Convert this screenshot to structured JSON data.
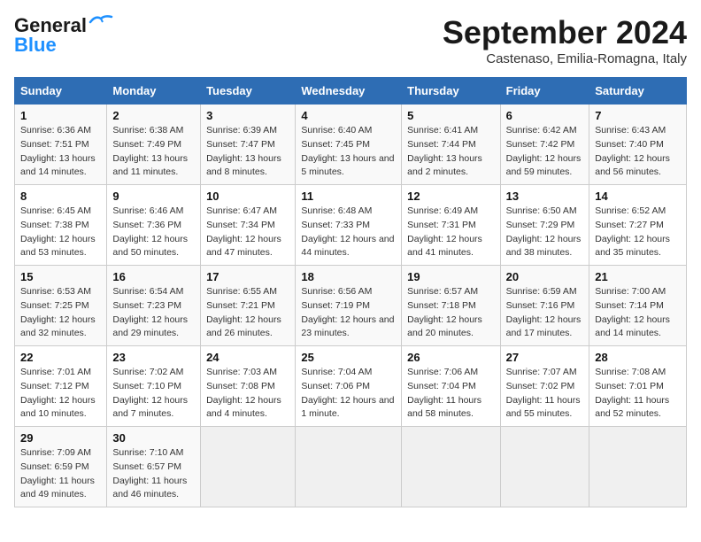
{
  "logo": {
    "line1": "General",
    "line2": "Blue"
  },
  "title": "September 2024",
  "subtitle": "Castenaso, Emilia-Romagna, Italy",
  "headers": [
    "Sunday",
    "Monday",
    "Tuesday",
    "Wednesday",
    "Thursday",
    "Friday",
    "Saturday"
  ],
  "weeks": [
    [
      {
        "day": "1",
        "sunrise": "6:36 AM",
        "sunset": "7:51 PM",
        "daylight": "13 hours and 14 minutes."
      },
      {
        "day": "2",
        "sunrise": "6:38 AM",
        "sunset": "7:49 PM",
        "daylight": "13 hours and 11 minutes."
      },
      {
        "day": "3",
        "sunrise": "6:39 AM",
        "sunset": "7:47 PM",
        "daylight": "13 hours and 8 minutes."
      },
      {
        "day": "4",
        "sunrise": "6:40 AM",
        "sunset": "7:45 PM",
        "daylight": "13 hours and 5 minutes."
      },
      {
        "day": "5",
        "sunrise": "6:41 AM",
        "sunset": "7:44 PM",
        "daylight": "13 hours and 2 minutes."
      },
      {
        "day": "6",
        "sunrise": "6:42 AM",
        "sunset": "7:42 PM",
        "daylight": "12 hours and 59 minutes."
      },
      {
        "day": "7",
        "sunrise": "6:43 AM",
        "sunset": "7:40 PM",
        "daylight": "12 hours and 56 minutes."
      }
    ],
    [
      {
        "day": "8",
        "sunrise": "6:45 AM",
        "sunset": "7:38 PM",
        "daylight": "12 hours and 53 minutes."
      },
      {
        "day": "9",
        "sunrise": "6:46 AM",
        "sunset": "7:36 PM",
        "daylight": "12 hours and 50 minutes."
      },
      {
        "day": "10",
        "sunrise": "6:47 AM",
        "sunset": "7:34 PM",
        "daylight": "12 hours and 47 minutes."
      },
      {
        "day": "11",
        "sunrise": "6:48 AM",
        "sunset": "7:33 PM",
        "daylight": "12 hours and 44 minutes."
      },
      {
        "day": "12",
        "sunrise": "6:49 AM",
        "sunset": "7:31 PM",
        "daylight": "12 hours and 41 minutes."
      },
      {
        "day": "13",
        "sunrise": "6:50 AM",
        "sunset": "7:29 PM",
        "daylight": "12 hours and 38 minutes."
      },
      {
        "day": "14",
        "sunrise": "6:52 AM",
        "sunset": "7:27 PM",
        "daylight": "12 hours and 35 minutes."
      }
    ],
    [
      {
        "day": "15",
        "sunrise": "6:53 AM",
        "sunset": "7:25 PM",
        "daylight": "12 hours and 32 minutes."
      },
      {
        "day": "16",
        "sunrise": "6:54 AM",
        "sunset": "7:23 PM",
        "daylight": "12 hours and 29 minutes."
      },
      {
        "day": "17",
        "sunrise": "6:55 AM",
        "sunset": "7:21 PM",
        "daylight": "12 hours and 26 minutes."
      },
      {
        "day": "18",
        "sunrise": "6:56 AM",
        "sunset": "7:19 PM",
        "daylight": "12 hours and 23 minutes."
      },
      {
        "day": "19",
        "sunrise": "6:57 AM",
        "sunset": "7:18 PM",
        "daylight": "12 hours and 20 minutes."
      },
      {
        "day": "20",
        "sunrise": "6:59 AM",
        "sunset": "7:16 PM",
        "daylight": "12 hours and 17 minutes."
      },
      {
        "day": "21",
        "sunrise": "7:00 AM",
        "sunset": "7:14 PM",
        "daylight": "12 hours and 14 minutes."
      }
    ],
    [
      {
        "day": "22",
        "sunrise": "7:01 AM",
        "sunset": "7:12 PM",
        "daylight": "12 hours and 10 minutes."
      },
      {
        "day": "23",
        "sunrise": "7:02 AM",
        "sunset": "7:10 PM",
        "daylight": "12 hours and 7 minutes."
      },
      {
        "day": "24",
        "sunrise": "7:03 AM",
        "sunset": "7:08 PM",
        "daylight": "12 hours and 4 minutes."
      },
      {
        "day": "25",
        "sunrise": "7:04 AM",
        "sunset": "7:06 PM",
        "daylight": "12 hours and 1 minute."
      },
      {
        "day": "26",
        "sunrise": "7:06 AM",
        "sunset": "7:04 PM",
        "daylight": "11 hours and 58 minutes."
      },
      {
        "day": "27",
        "sunrise": "7:07 AM",
        "sunset": "7:02 PM",
        "daylight": "11 hours and 55 minutes."
      },
      {
        "day": "28",
        "sunrise": "7:08 AM",
        "sunset": "7:01 PM",
        "daylight": "11 hours and 52 minutes."
      }
    ],
    [
      {
        "day": "29",
        "sunrise": "7:09 AM",
        "sunset": "6:59 PM",
        "daylight": "11 hours and 49 minutes."
      },
      {
        "day": "30",
        "sunrise": "7:10 AM",
        "sunset": "6:57 PM",
        "daylight": "11 hours and 46 minutes."
      },
      null,
      null,
      null,
      null,
      null
    ]
  ],
  "labels": {
    "sunrise": "Sunrise: ",
    "sunset": "Sunset: ",
    "daylight": "Daylight: "
  }
}
